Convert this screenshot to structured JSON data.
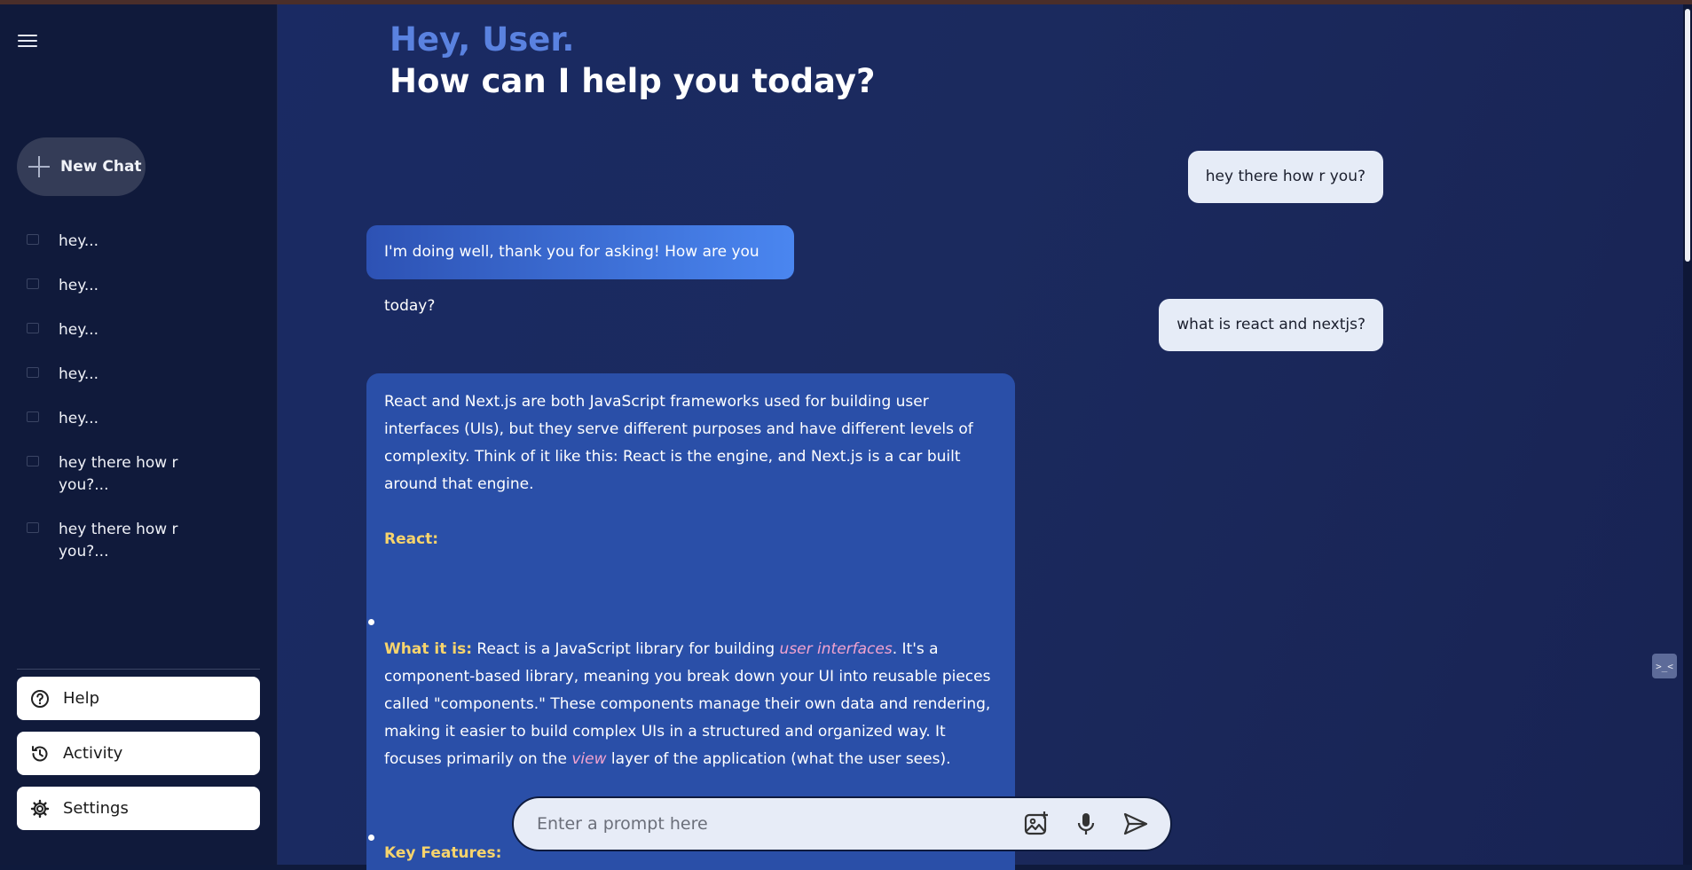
{
  "sidebar": {
    "new_chat_label": "New Chat",
    "recent": [
      {
        "label": "hey..."
      },
      {
        "label": "hey..."
      },
      {
        "label": "hey..."
      },
      {
        "label": "hey..."
      },
      {
        "label": "hey..."
      },
      {
        "label": "hey there how r you?..."
      },
      {
        "label": "hey there how r you?..."
      }
    ],
    "bottom": {
      "help": "Help",
      "activity": "Activity",
      "settings": "Settings"
    }
  },
  "greeting": {
    "line1": "Hey, User.",
    "line2": "How can I help you today?"
  },
  "messages": {
    "user1": "hey there how r you?",
    "bot1": "I'm doing well, thank you for asking!  How are you today?",
    "user2": "what is react and nextjs?",
    "bot2": {
      "intro": "React and Next.js are both JavaScript frameworks used for building user interfaces (UIs), but they serve different purposes and have different levels of complexity.  Think of it like this: React is the engine, and Next.js is a car built around that engine.",
      "heading": "React:",
      "what_label": "What it is:",
      "what_text_a": " React is a JavaScript library for building ",
      "what_em1": "user interfaces",
      "what_text_b": ".  It's a component-based library, meaning you break down your UI into reusable pieces called \"components.\"  These components manage their own data and rendering, making it easier to build complex UIs in a structured and organized way.  It focuses primarily on the ",
      "what_em2": "view",
      "what_text_c": " layer of the application (what the user sees).",
      "next_heading": "Key Features:"
    }
  },
  "prompt": {
    "placeholder": "Enter a prompt here"
  },
  "icons": {
    "menu": "hamburger-icon",
    "plus": "plus-icon",
    "help": "question-circle-icon",
    "activity": "history-icon",
    "settings": "gear-icon",
    "image": "image-add-icon",
    "mic": "mic-icon",
    "send": "send-icon"
  },
  "colors": {
    "accent": "#5a82e0",
    "highlight_yellow": "#f7d46c",
    "highlight_pink": "#f3a3cf"
  }
}
